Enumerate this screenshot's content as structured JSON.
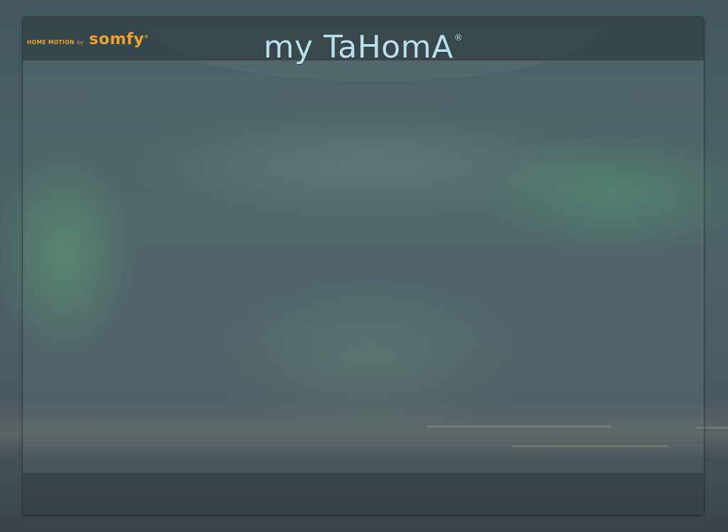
{
  "header": {
    "brand_tagline": "HOME MOTION",
    "brand_by": "by",
    "brand_name": "somfy",
    "brand_reg": "®",
    "app_title": "my TaHomA",
    "app_title_reg": "®"
  },
  "colors": {
    "brand": "#f0a32c",
    "title": "#b9e0ec"
  }
}
